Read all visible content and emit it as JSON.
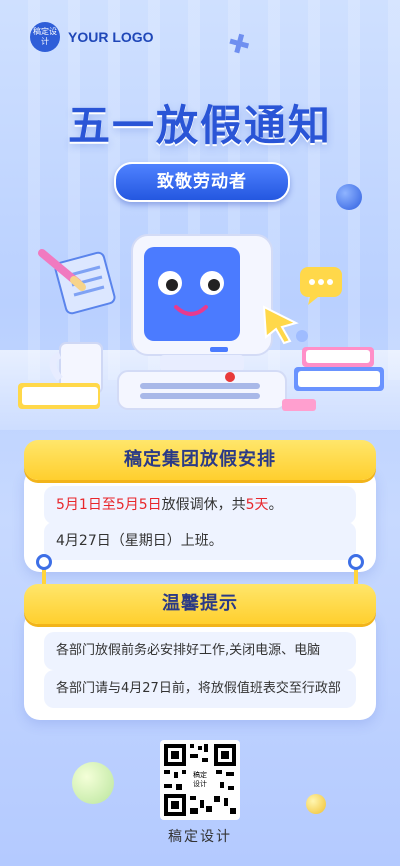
{
  "logo": {
    "badge_text": "稿定设计",
    "text": "YOUR LOGO"
  },
  "title": "五一放假通知",
  "subtitle": "致敬劳动者",
  "section1": {
    "heading": "稿定集团放假安排",
    "line1": {
      "part1": "5月1日至5月5日",
      "part2": "放假调休，共",
      "part3": "5天",
      "part4": "。"
    },
    "line2": "4月27日（星期日）上班。"
  },
  "section2": {
    "heading": "温馨提示",
    "line1": "各部门放假前务必安排好工作,关闭电源、电脑",
    "line2": "各部门请与4月27日前，将放假值班表交至行政部"
  },
  "qr": {
    "center_text": "稿定设计",
    "caption": "稿定设计"
  },
  "colors": {
    "primary_blue": "#2a55d6",
    "yellow": "#ffd43a",
    "highlight_red": "#e8262b"
  },
  "icons": [
    "x-icon",
    "pencil-notepad-icon",
    "chat-bubble-icon",
    "computer-mascot-icon",
    "mug-icon",
    "books-icon",
    "keyboard-icon",
    "cursor-icon",
    "qr-code-icon"
  ]
}
